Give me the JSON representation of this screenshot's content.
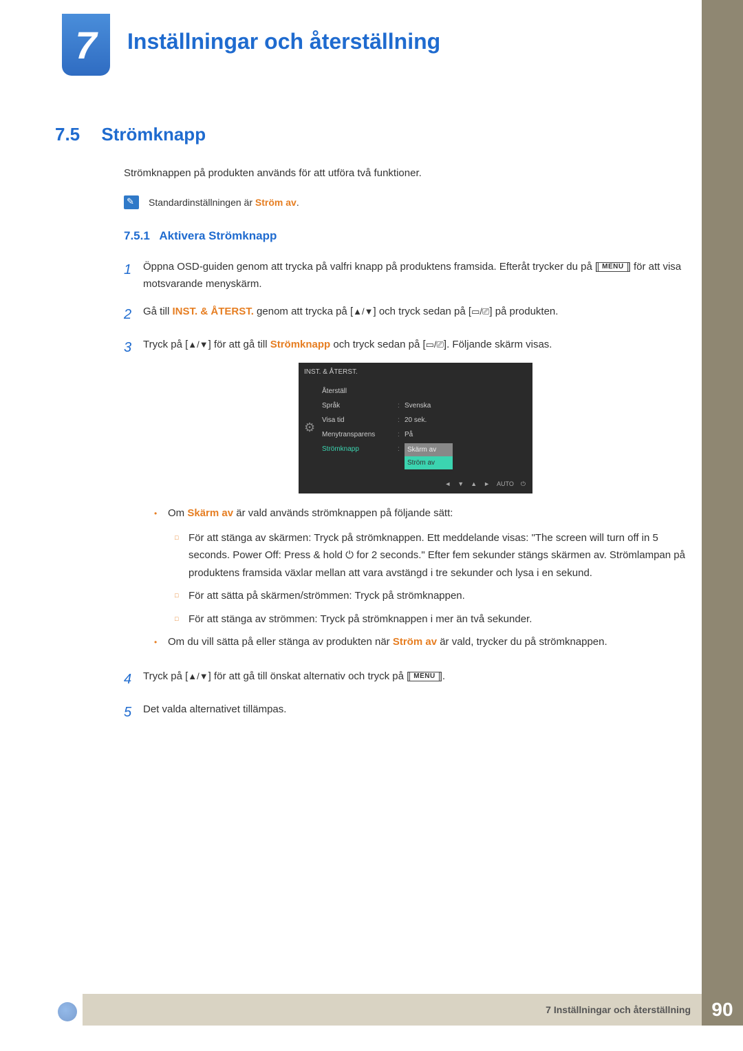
{
  "chapter": {
    "number": "7",
    "title": "Inställningar och återställning"
  },
  "section": {
    "number": "7.5",
    "title": "Strömknapp",
    "intro": "Strömknappen på produkten används för att utföra två funktioner.",
    "note_prefix": "Standardinställningen är ",
    "note_value": "Ström av",
    "note_suffix": "."
  },
  "subsection": {
    "number": "7.5.1",
    "title": "Aktivera Strömknapp"
  },
  "steps": {
    "s1_a": "Öppna OSD-guiden genom att trycka på valfri knapp på produktens framsida. Efteråt trycker du på [",
    "s1_menu": "MENU",
    "s1_b": "] för att visa motsvarande menyskärm.",
    "s2_a": "Gå till ",
    "s2_inst": "INST. & ÅTERST.",
    "s2_b": " genom att trycka på [",
    "s2_c": "] och tryck sedan på [",
    "s2_d": "] på produkten.",
    "s3_a": "Tryck på [",
    "s3_b": "] för att gå till ",
    "s3_term": "Strömknapp",
    "s3_c": " och tryck sedan på [",
    "s3_d": "]. Följande skärm visas.",
    "s4_a": "Tryck på [",
    "s4_b": "] för att gå till önskat alternativ och tryck på [",
    "s4_menu": "MENU",
    "s4_c": "].",
    "s5": "Det valda alternativet tillämpas."
  },
  "osd": {
    "title": "INST. & ÅTERST.",
    "r1": "Återställ",
    "r2": "Språk",
    "r2v": "Svenska",
    "r3": "Visa tid",
    "r3v": "20 sek.",
    "r4": "Menytransparens",
    "r4v": "På",
    "r5": "Strömknapp",
    "opt1": "Skärm av",
    "opt2": "Ström av",
    "auto": "AUTO"
  },
  "bullets": {
    "b1_a": "Om ",
    "b1_term": "Skärm av",
    "b1_b": " är vald används strömknappen på följande sätt:",
    "sb1": "För att stänga av skärmen: Tryck på strömknappen. Ett meddelande visas: \"The screen will turn off in 5 seconds. Power Off: Press & hold ⏻ for 2 seconds.\" Efter fem sekunder stängs skärmen av. Strömlampan på produktens framsida växlar mellan att vara avstängd i tre sekunder och lysa i en sekund.",
    "sb2": "För att sätta på skärmen/strömmen: Tryck på strömknappen.",
    "sb3": "För att stänga av strömmen: Tryck på strömknappen i mer än två sekunder.",
    "b2_a": "Om du vill sätta på eller stänga av produkten när ",
    "b2_term": "Ström av",
    "b2_b": " är vald, trycker du på strömknappen."
  },
  "footer": {
    "text": "7 Inställningar och återställning",
    "page": "90"
  }
}
